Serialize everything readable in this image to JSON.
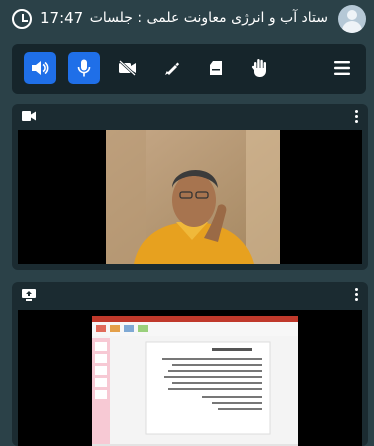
{
  "header": {
    "time": "17:47",
    "title": "ستاد آب و انرژی معاونت علمی : جلسات",
    "clock_icon": "clock-icon",
    "avatar_icon": "user-avatar-icon"
  },
  "toolbar": {
    "accent_color": "#1f6fe8",
    "buttons": [
      {
        "name": "speaker-icon",
        "active": true
      },
      {
        "name": "microphone-icon",
        "active": true
      },
      {
        "name": "camera-off-icon",
        "active": false
      },
      {
        "name": "pen-icon",
        "active": false
      },
      {
        "name": "eraser-icon",
        "active": false
      },
      {
        "name": "raise-hand-icon",
        "active": false
      },
      {
        "name": "menu-icon",
        "active": false
      }
    ]
  },
  "panels": [
    {
      "name": "video-panel",
      "icon": "video-camera-icon",
      "menu_icon": "kebab-menu-icon"
    },
    {
      "name": "screen-share-panel",
      "icon": "screen-share-icon",
      "menu_icon": "kebab-menu-icon"
    }
  ]
}
